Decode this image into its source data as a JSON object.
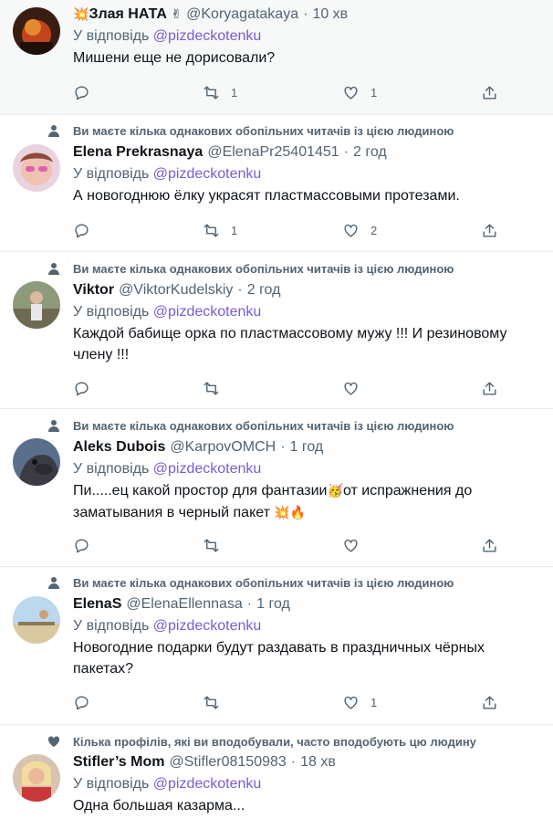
{
  "reply_prefix": "У відповідь",
  "reply_to": "@pizdeckotenku",
  "social_same_followers": "Ви маєте кілька однакових обопільних читачів із цією людиною",
  "social_liked_profiles": "Кілька профілів, які ви вподобували, часто вподобують цю людину",
  "tweets": [
    {
      "name_emoji_pre": "💥",
      "name": "Злая НАТА",
      "name_emoji_post": "✌",
      "handle": "@Koryagatakaya",
      "time": "10 хв",
      "text": "Мишени еще не дорисовали?",
      "replies": "",
      "retweets": "1",
      "likes": "1"
    },
    {
      "name": "Elena Prekrasnaya",
      "handle": "@ElenaPr25401451",
      "time": "2 год",
      "text": "А новогоднюю ёлку украсят пластмассовыми протезами.",
      "replies": "",
      "retweets": "1",
      "likes": "2"
    },
    {
      "name": "Viktor",
      "handle": "@ViktorKudelskiy",
      "time": "2 год",
      "text": "Каждой бабище орка по пластмассовому мужу !!! И резиновому члену !!!",
      "replies": "",
      "retweets": "",
      "likes": ""
    },
    {
      "name": "Aleks Dubois",
      "handle": "@KarpovOMCH",
      "time": "1 год",
      "text_a": "Пи.....ец какой простор для фантазии",
      "text_emoji_1": "🥳",
      "text_b": "от испражнения до заматывания в черный пакет ",
      "text_emoji_2": "💥🔥",
      "replies": "",
      "retweets": "",
      "likes": ""
    },
    {
      "name": "ElenaS",
      "handle": "@ElenaEllennasa",
      "time": "1 год",
      "text": "Новогодние подарки будут раздавать в праздничных чёрных пакетах?",
      "replies": "",
      "retweets": "",
      "likes": "1"
    },
    {
      "name": "Stifler’s Mom",
      "handle": "@Stifler08150983",
      "time": "18 хв",
      "text": "Одна большая казарма...",
      "replies": "",
      "retweets": "",
      "likes": ""
    }
  ]
}
